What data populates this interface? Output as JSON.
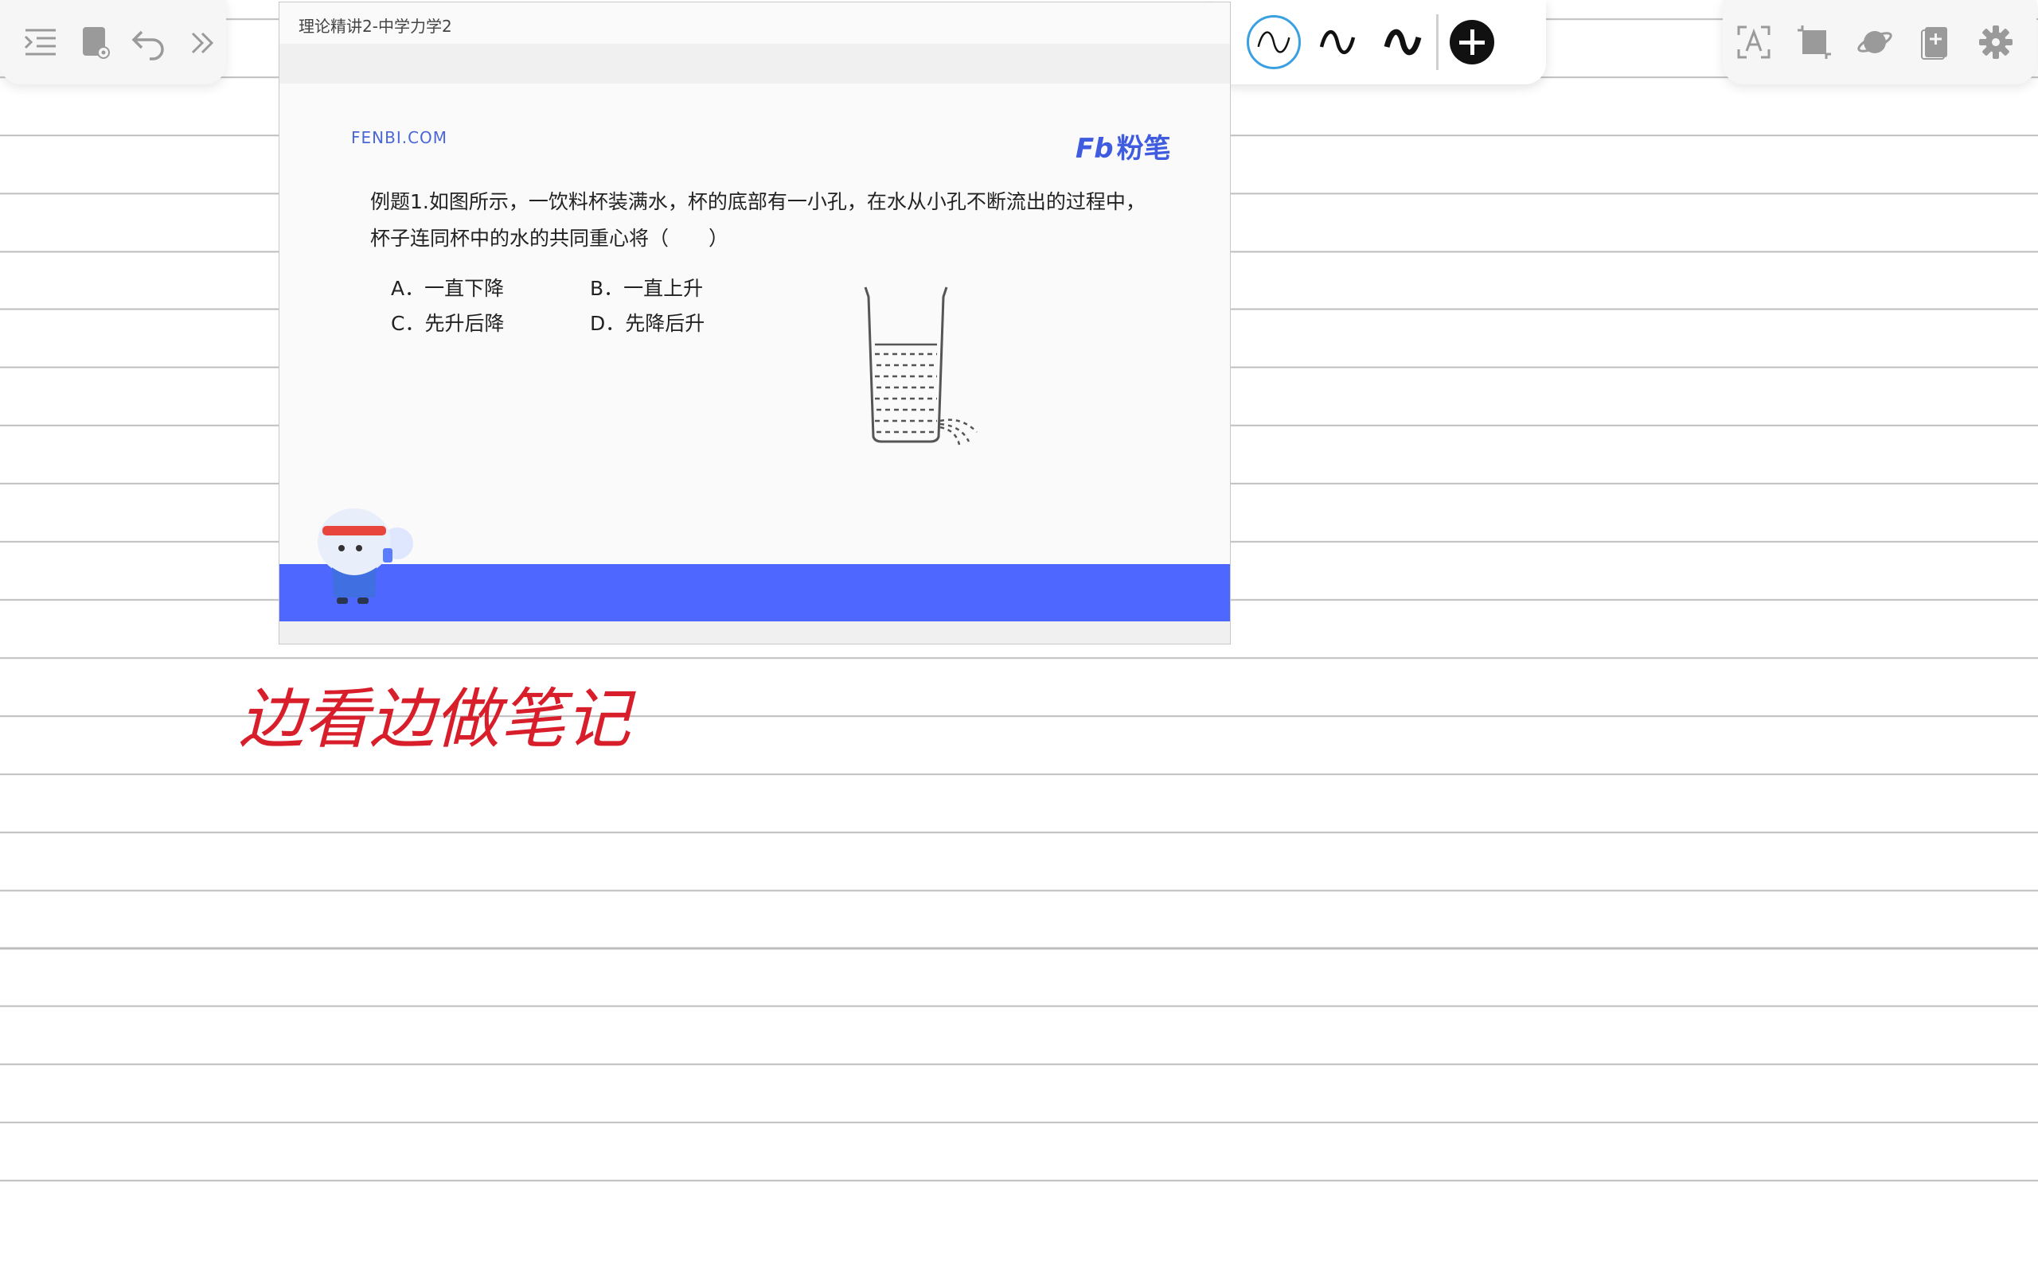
{
  "toolbar_left": {
    "icons": [
      "outline-icon",
      "notebook-icon",
      "undo-icon",
      "expand-icon"
    ]
  },
  "toolbar_pens": {
    "pens": [
      "pen-thin",
      "pen-medium",
      "pen-thick"
    ],
    "selected_pen": 0,
    "add_icon": "plus-circle-icon"
  },
  "toolbar_right": {
    "icons": [
      "text-recognize-icon",
      "crop-icon",
      "planet-icon",
      "add-page-icon",
      "gear-icon"
    ]
  },
  "slide": {
    "title": "理论精讲2-中学力学2",
    "brand_url": "FENBI.COM",
    "brand_logo_fb": "Fb",
    "brand_logo_text": "粉笔",
    "question_line1": "例题1.如图所示，一饮料杯装满水，杯的底部有一小孔，在水从小孔不断流出的过程中，",
    "question_line2": "杯子连同杯中的水的共同重心将（　　）",
    "options": [
      {
        "label": "A．一直下降"
      },
      {
        "label": "B．一直上升"
      },
      {
        "label": "C．先升后降"
      },
      {
        "label": "D．先降后升"
      }
    ],
    "band_color": "#4e67ff"
  },
  "handwriting": {
    "text": "边看边做笔记",
    "color": "#d81e2a"
  },
  "colors": {
    "accent_blue": "#3aa0e0",
    "brand_blue": "#3f5be0",
    "ink_red": "#d81e2a"
  }
}
